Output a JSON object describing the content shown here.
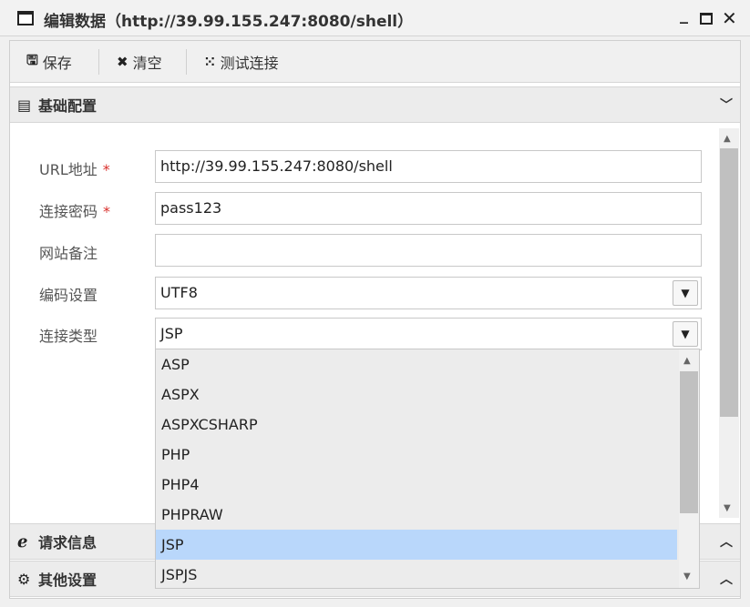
{
  "window": {
    "title": "编辑数据（http://39.99.155.247:8080/shell）",
    "minimize": "_",
    "close": "✕"
  },
  "toolbar": {
    "save_label": "保存",
    "clear_label": "清空",
    "test_label": "测试连接"
  },
  "sections": {
    "basic": "基础配置",
    "request": "请求信息",
    "other": "其他设置"
  },
  "form": {
    "url": {
      "label": "URL地址",
      "required": "*",
      "value": "http://39.99.155.247:8080/shell"
    },
    "password": {
      "label": "连接密码",
      "required": "*",
      "value": "pass123"
    },
    "note": {
      "label": "网站备注",
      "value": ""
    },
    "encoding": {
      "label": "编码设置",
      "value": "UTF8"
    },
    "type": {
      "label": "连接类型",
      "value": "JSP"
    }
  },
  "dropdown": {
    "options": [
      "ASP",
      "ASPX",
      "ASPXCSHARP",
      "PHP",
      "PHP4",
      "PHPRAW",
      "JSP",
      "JSPJS"
    ],
    "selected": "JSP"
  }
}
